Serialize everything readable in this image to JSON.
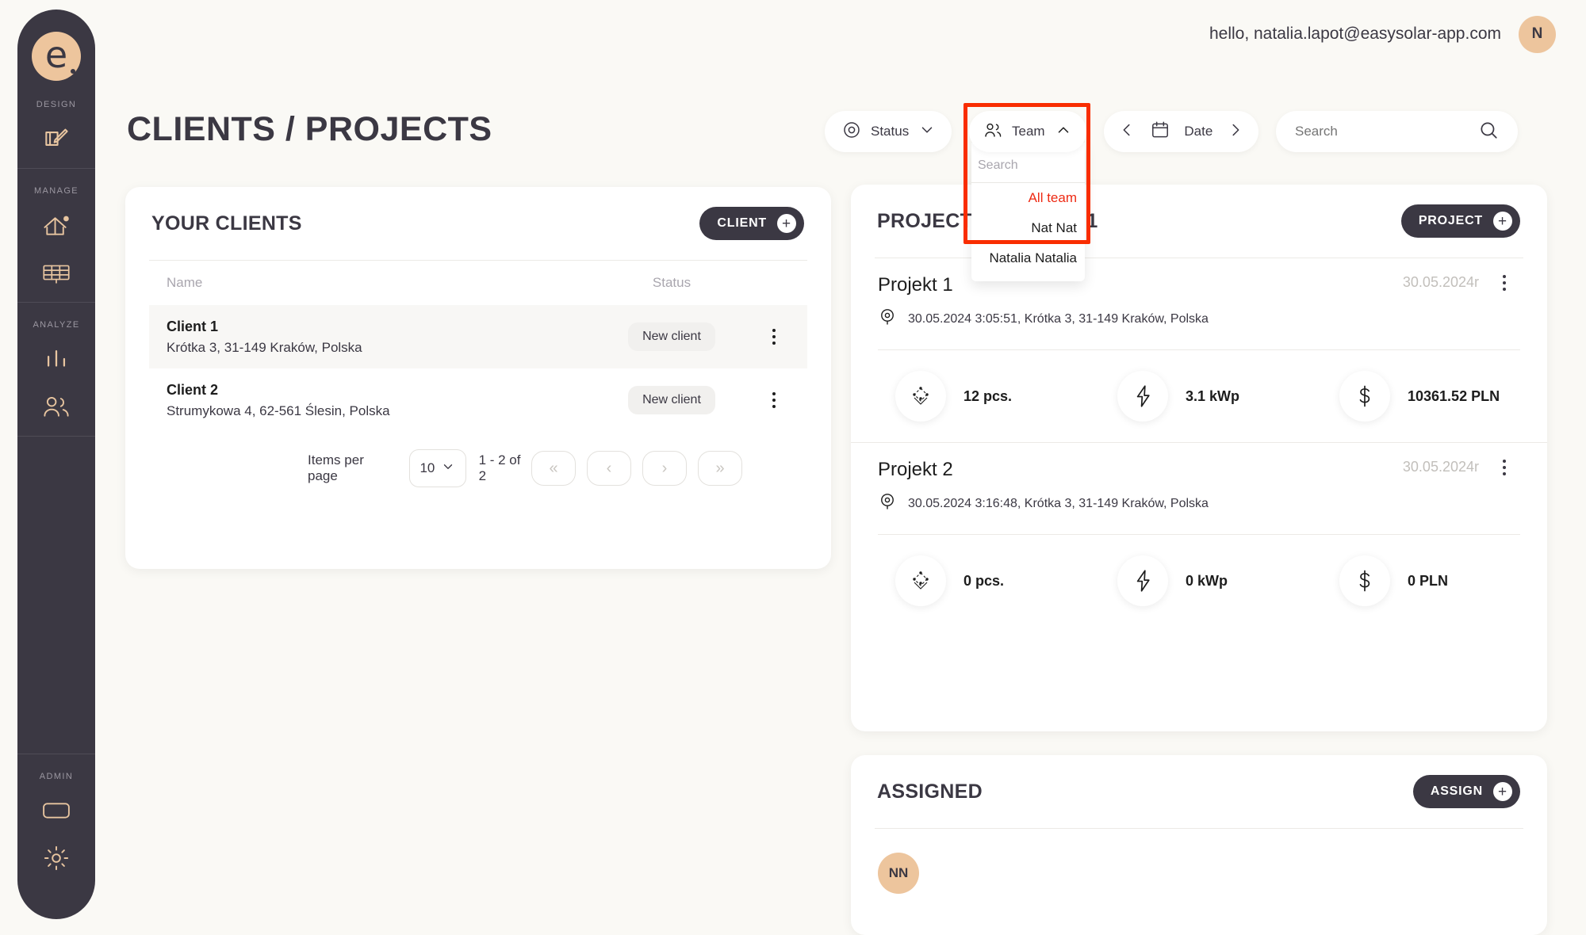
{
  "header": {
    "greeting": "hello, natalia.lapot@easysolar-app.com",
    "avatar_initial": "N"
  },
  "page": {
    "title": "CLIENTS / PROJECTS"
  },
  "sidebar": {
    "logo_letter": "e",
    "groups": [
      {
        "label": "DESIGN",
        "icons": [
          {
            "name": "design-pen-icon"
          }
        ]
      },
      {
        "label": "MANAGE",
        "icons": [
          {
            "name": "house-icon"
          },
          {
            "name": "solar-panel-icon"
          }
        ]
      },
      {
        "label": "ANALYZE",
        "icons": [
          {
            "name": "bar-chart-icon"
          },
          {
            "name": "people-icon"
          }
        ]
      },
      {
        "label": "ADMIN",
        "icons": [
          {
            "name": "card-icon"
          },
          {
            "name": "gear-icon"
          }
        ]
      }
    ]
  },
  "filters": {
    "status": {
      "label": "Status",
      "icon": "target-icon",
      "chevron": "chevron-down-icon"
    },
    "team": {
      "label": "Team",
      "icon": "people-icon",
      "chevron": "chevron-up-icon",
      "expanded": true,
      "search_placeholder": "Search",
      "search_value": "",
      "options": [
        {
          "label": "All team",
          "selected": true
        },
        {
          "label": "Nat Nat",
          "selected": false
        },
        {
          "label": "Natalia Natalia",
          "selected": false
        }
      ],
      "highlight_color": "#f92d00",
      "selected_color": "#ee2a13"
    },
    "date": {
      "label": "Date",
      "icon": "calendar-icon",
      "prev": "‹",
      "next": "›"
    },
    "search": {
      "placeholder": "Search",
      "value": "",
      "icon": "search-icon"
    }
  },
  "clients_card": {
    "title": "YOUR CLIENTS",
    "add_button": "CLIENT",
    "columns": {
      "name": "Name",
      "status": "Status"
    },
    "rows": [
      {
        "name": "Client 1",
        "address": "Krótka 3, 31-149 Kraków, Polska",
        "status": "New client",
        "active": true
      },
      {
        "name": "Client 2",
        "address": "Strumykowa 4, 62-561 Ślesin, Polska",
        "status": "New client",
        "active": false
      }
    ],
    "pagination": {
      "items_per_page_label": "Items per page",
      "page_size": "10",
      "range": "1 - 2 of 2",
      "first": "«",
      "prev": "‹",
      "next": "›",
      "last": "»"
    }
  },
  "projects_card": {
    "title_visible_prefix": "PROJECTS",
    "title_visible_suffix": "1",
    "add_button": "PROJECT",
    "projects": [
      {
        "name": "Projekt 1",
        "date": "30.05.2024r",
        "location": "30.05.2024 3:05:51, Krótka 3, 31-149 Kraków, Polska",
        "stats": [
          {
            "icon": "solar-modules-icon",
            "value": "12 pcs."
          },
          {
            "icon": "bolt-icon",
            "value": "3.1 kWp"
          },
          {
            "icon": "dollar-icon",
            "value": "10361.52 PLN"
          }
        ]
      },
      {
        "name": "Projekt 2",
        "date": "30.05.2024r",
        "location": "30.05.2024 3:16:48, Krótka 3, 31-149 Kraków, Polska",
        "stats": [
          {
            "icon": "solar-modules-icon",
            "value": "0 pcs."
          },
          {
            "icon": "bolt-icon",
            "value": "0 kWp"
          },
          {
            "icon": "dollar-icon",
            "value": "0 PLN"
          }
        ]
      }
    ]
  },
  "assigned_card": {
    "title": "ASSIGNED",
    "add_button": "ASSIGN",
    "assignees": [
      {
        "initials": "NN"
      }
    ]
  },
  "colors": {
    "sidebar_bg": "#3b3843",
    "accent_peach": "#edc59d",
    "page_bg": "#faf9f5",
    "text_dark": "#3b3843",
    "annotation_red": "#f92d00"
  }
}
